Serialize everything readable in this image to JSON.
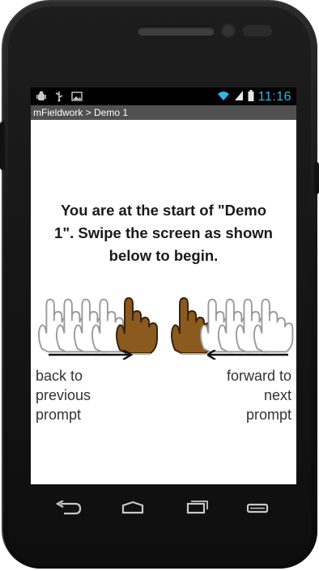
{
  "statusbar": {
    "time": "11:16",
    "icons": [
      "android-debug-icon",
      "usb-icon",
      "image-icon",
      "wifi-icon",
      "signal-icon",
      "battery-icon"
    ]
  },
  "app": {
    "title": "mFieldwork > Demo 1"
  },
  "instructions": {
    "line1": "You are at the start of \"Demo",
    "line2": "1\". Swipe the screen as shown",
    "line3": "below to begin."
  },
  "swipe": {
    "back": {
      "line1": "back to",
      "line2": "previous",
      "line3": "prompt"
    },
    "forward": {
      "line1": "forward to",
      "line2": "next",
      "line3": "prompt"
    }
  },
  "navbar": {
    "buttons": [
      "back-icon",
      "home-icon",
      "recent-apps-icon",
      "menu-icon"
    ]
  },
  "colors": {
    "accent": "#33b5e5",
    "hand": "#8b5a1e",
    "titlebar": "#505050"
  }
}
